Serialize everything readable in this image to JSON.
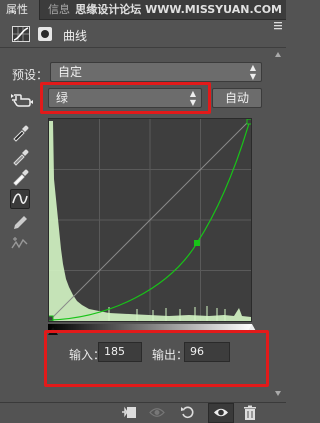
{
  "tabs": {
    "properties": "属性",
    "info": "信息"
  },
  "watermark": "思缘设计论坛 WWW.MISSYUAN.COM",
  "header": {
    "title": "曲线",
    "adjustment_icon": "curves-adjustment-icon",
    "mask_icon": "layer-mask-icon"
  },
  "preset": {
    "label": "预设：",
    "value": "自定"
  },
  "channel": {
    "value": "绿",
    "auto_label": "自动"
  },
  "tools": [
    "on-image-adjust-icon",
    "sample-black-eyedropper-icon",
    "sample-gray-eyedropper-icon",
    "sample-white-eyedropper-icon",
    "curve-edit-icon",
    "pencil-draw-icon",
    "smooth-curve-icon"
  ],
  "io": {
    "input_label": "输入：",
    "input_value": "185",
    "output_label": "输出：",
    "output_value": "96"
  },
  "colors": {
    "curve": "#18c418",
    "highlight_box": "#e21a1a",
    "histogram": "#d4f5c4"
  },
  "bottom_icons": [
    "clip-to-layer-icon",
    "view-previous-icon",
    "reset-icon",
    "visibility-eye-icon",
    "trash-icon"
  ]
}
